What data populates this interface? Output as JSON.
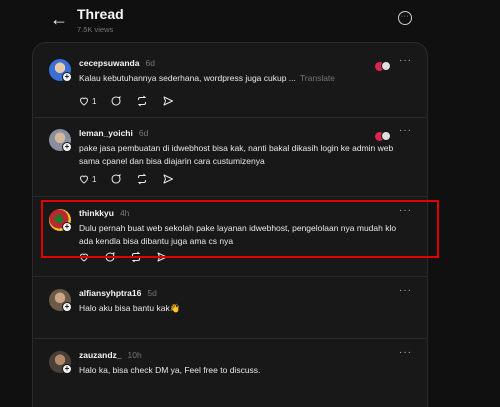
{
  "header": {
    "title": "Thread",
    "views": "7.5K views"
  },
  "posts": [
    {
      "username": "cecepsuwanda",
      "time": "6d",
      "text": "Kalau kebutuhannya sederhana, wordpress juga cukup ...",
      "translate": "Translate",
      "like_count": "1",
      "avatar_color": "#3a6fd8"
    },
    {
      "username": "leman_yoichi",
      "time": "6d",
      "text": "pake jasa pembuatan di idwebhost bisa kak, nanti bakal dikasih login ke admin web sama cpanel dan bisa diajarin cara custumizenya",
      "like_count": "1",
      "avatar_color": "#8a8fa0"
    },
    {
      "username": "thinkkyu",
      "time": "4h",
      "text": "Dulu pernah buat web sekolah pake layanan idwebhost, pengelolaan nya mudah klo ada kendla bisa dibantu juga ama cs nya",
      "avatar_color": "#c0262d"
    },
    {
      "username": "alfiansyhptra16",
      "time": "5d",
      "text": "Halo aku bisa bantu kak👋",
      "avatar_color": "#6b5a4a"
    },
    {
      "username": "zauzandz_",
      "time": "10h",
      "text": "Halo ka, bisa check DM ya, Feel free to discuss.",
      "avatar_color": "#4a4038"
    }
  ],
  "colors": {
    "background": "#101010",
    "panel": "#181818",
    "highlight": "#e00000"
  }
}
